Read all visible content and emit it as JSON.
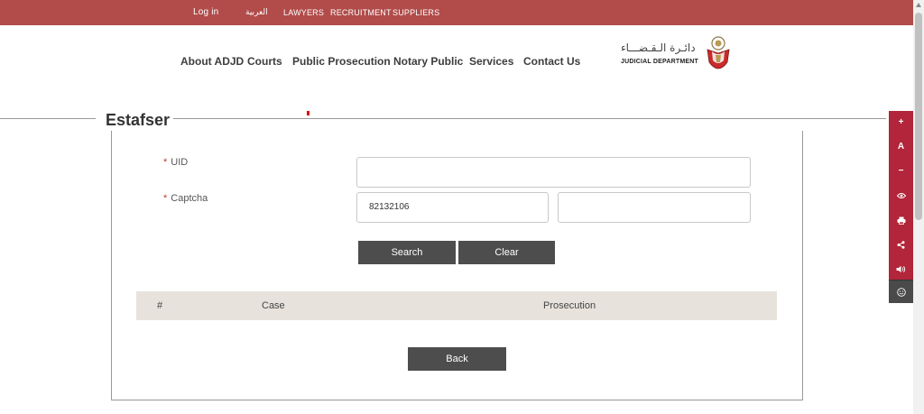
{
  "topbar": {
    "login": "Log in",
    "arabic": "العربية",
    "lawyers": "LAWYERS",
    "recruitment": "RECRUITMENT",
    "suppliers": "SUPPLIERS"
  },
  "nav": {
    "items": [
      "About ADJD",
      "Courts",
      "Public Prosecution",
      "Notary Public",
      "Services",
      "Contact Us"
    ]
  },
  "logo": {
    "arabic": "دائـرة الـقـضـــاء",
    "english": "JUDICIAL DEPARTMENT"
  },
  "page": {
    "title": "Estafser"
  },
  "form": {
    "required_mark": "*",
    "uid_label": "UID",
    "uid_value": "",
    "captcha_label": "Captcha",
    "captcha_code": "82132106",
    "captcha_input": "",
    "search_label": "Search",
    "clear_label": "Clear"
  },
  "table": {
    "headers": [
      "#",
      "Case",
      "Prosecution"
    ]
  },
  "back_label": "Back",
  "sidebar": {
    "buttons": [
      "+",
      "A",
      "−",
      "eye-icon",
      "print-icon",
      "share-icon",
      "speaker-icon",
      "smiley-icon"
    ]
  },
  "colors": {
    "topbar": "#b14c4a",
    "sidebar": "#b2253a",
    "button": "#4d4d4d",
    "table_header": "#e7e3dc"
  }
}
